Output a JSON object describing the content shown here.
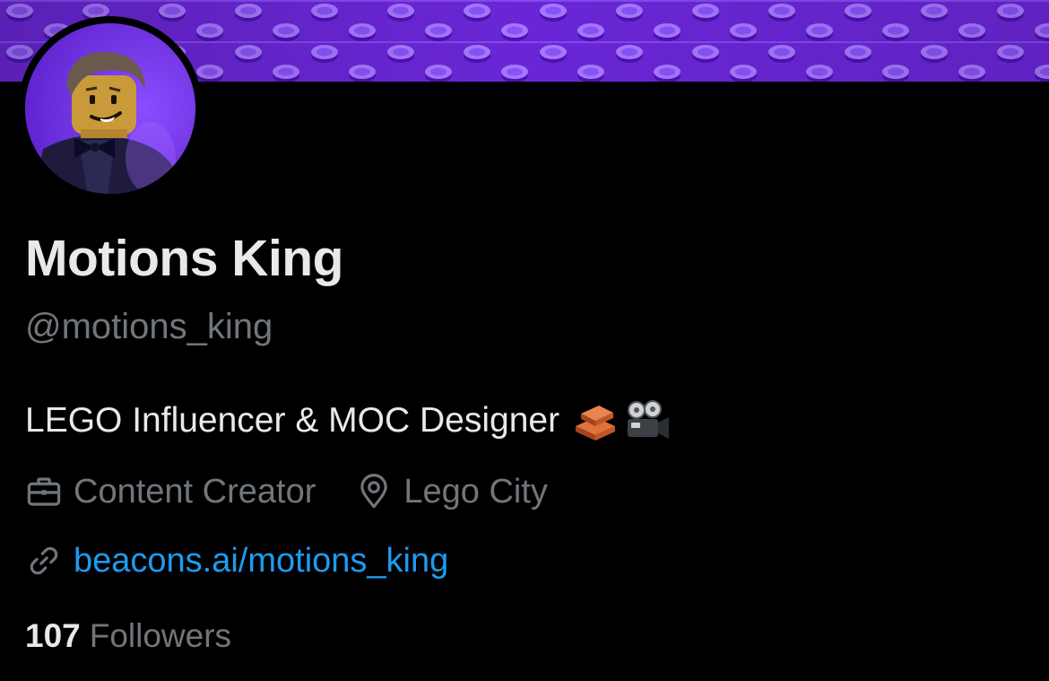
{
  "profile": {
    "display_name": "Motions King",
    "handle": "@motions_king",
    "bio": "LEGO Influencer & MOC Designer",
    "bio_emojis": [
      "brick-emoji",
      "movie-camera-emoji"
    ],
    "category": "Content Creator",
    "location": "Lego City",
    "link": "beacons.ai/motions_king",
    "followers_count": "107",
    "followers_label": "Followers"
  },
  "icons": {
    "category": "briefcase-icon",
    "location": "location-pin-icon",
    "link": "link-icon"
  },
  "colors": {
    "background": "#000000",
    "primary_text": "#e7e9ea",
    "secondary_text": "#71767b",
    "link": "#1d9bf0",
    "banner": "#6d28d9"
  }
}
